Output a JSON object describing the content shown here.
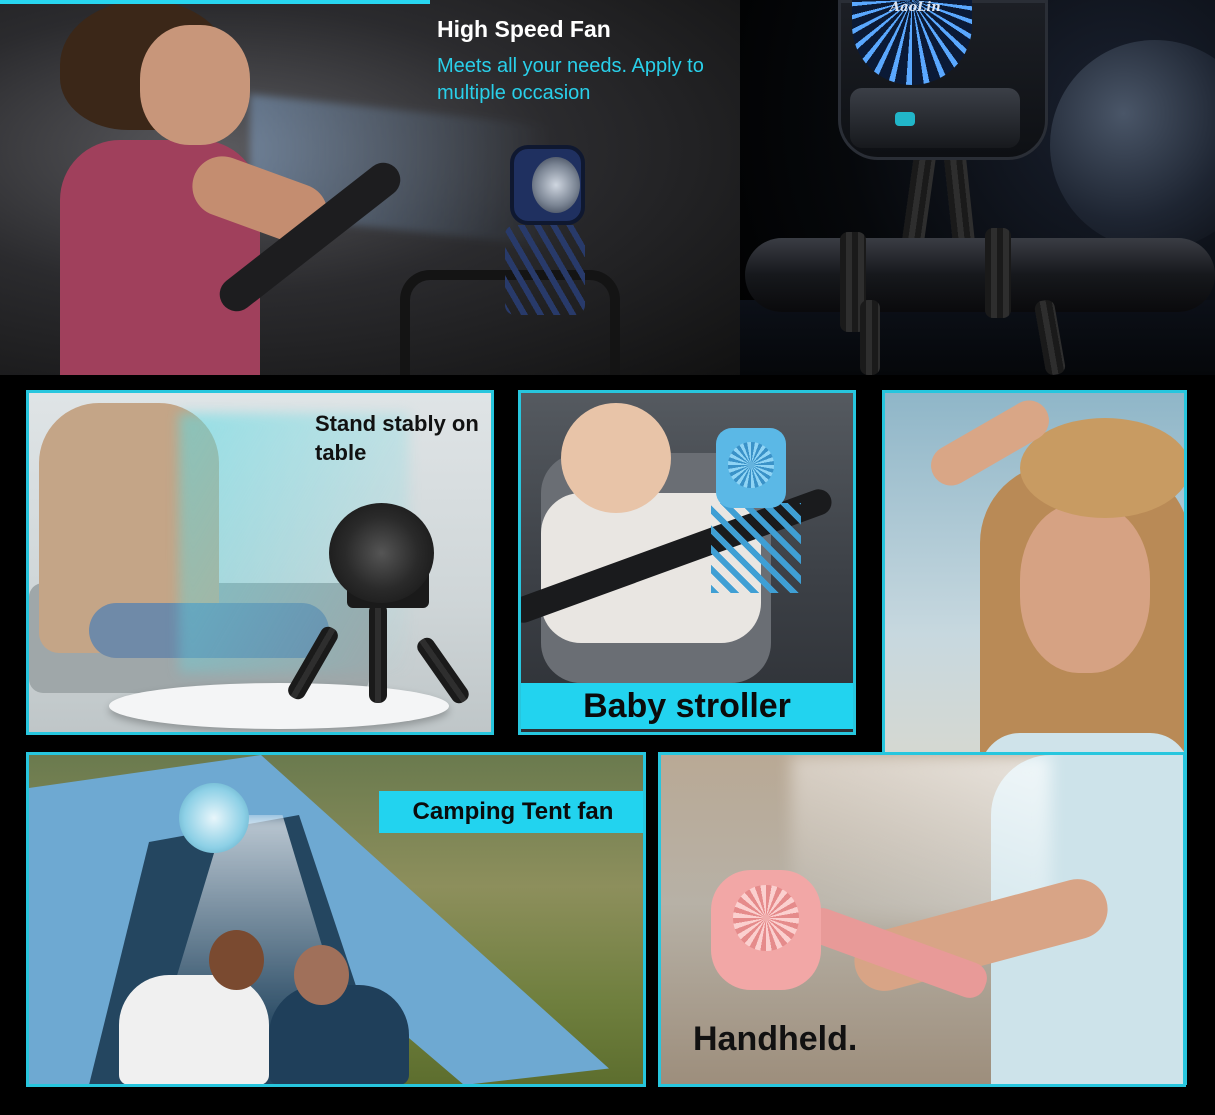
{
  "hero": {
    "title": "High Speed Fan",
    "subtitle": "Meets all your needs. Apply to multiple  occasion",
    "brand": "AaoLin"
  },
  "panels": {
    "table": {
      "caption": "Stand stably on table"
    },
    "stroller": {
      "caption": "Baby stroller"
    },
    "tent": {
      "caption": "Camping Tent fan"
    },
    "handheld": {
      "caption": "Handheld."
    }
  },
  "colors": {
    "accent": "#22d3ef",
    "background": "#000000"
  }
}
